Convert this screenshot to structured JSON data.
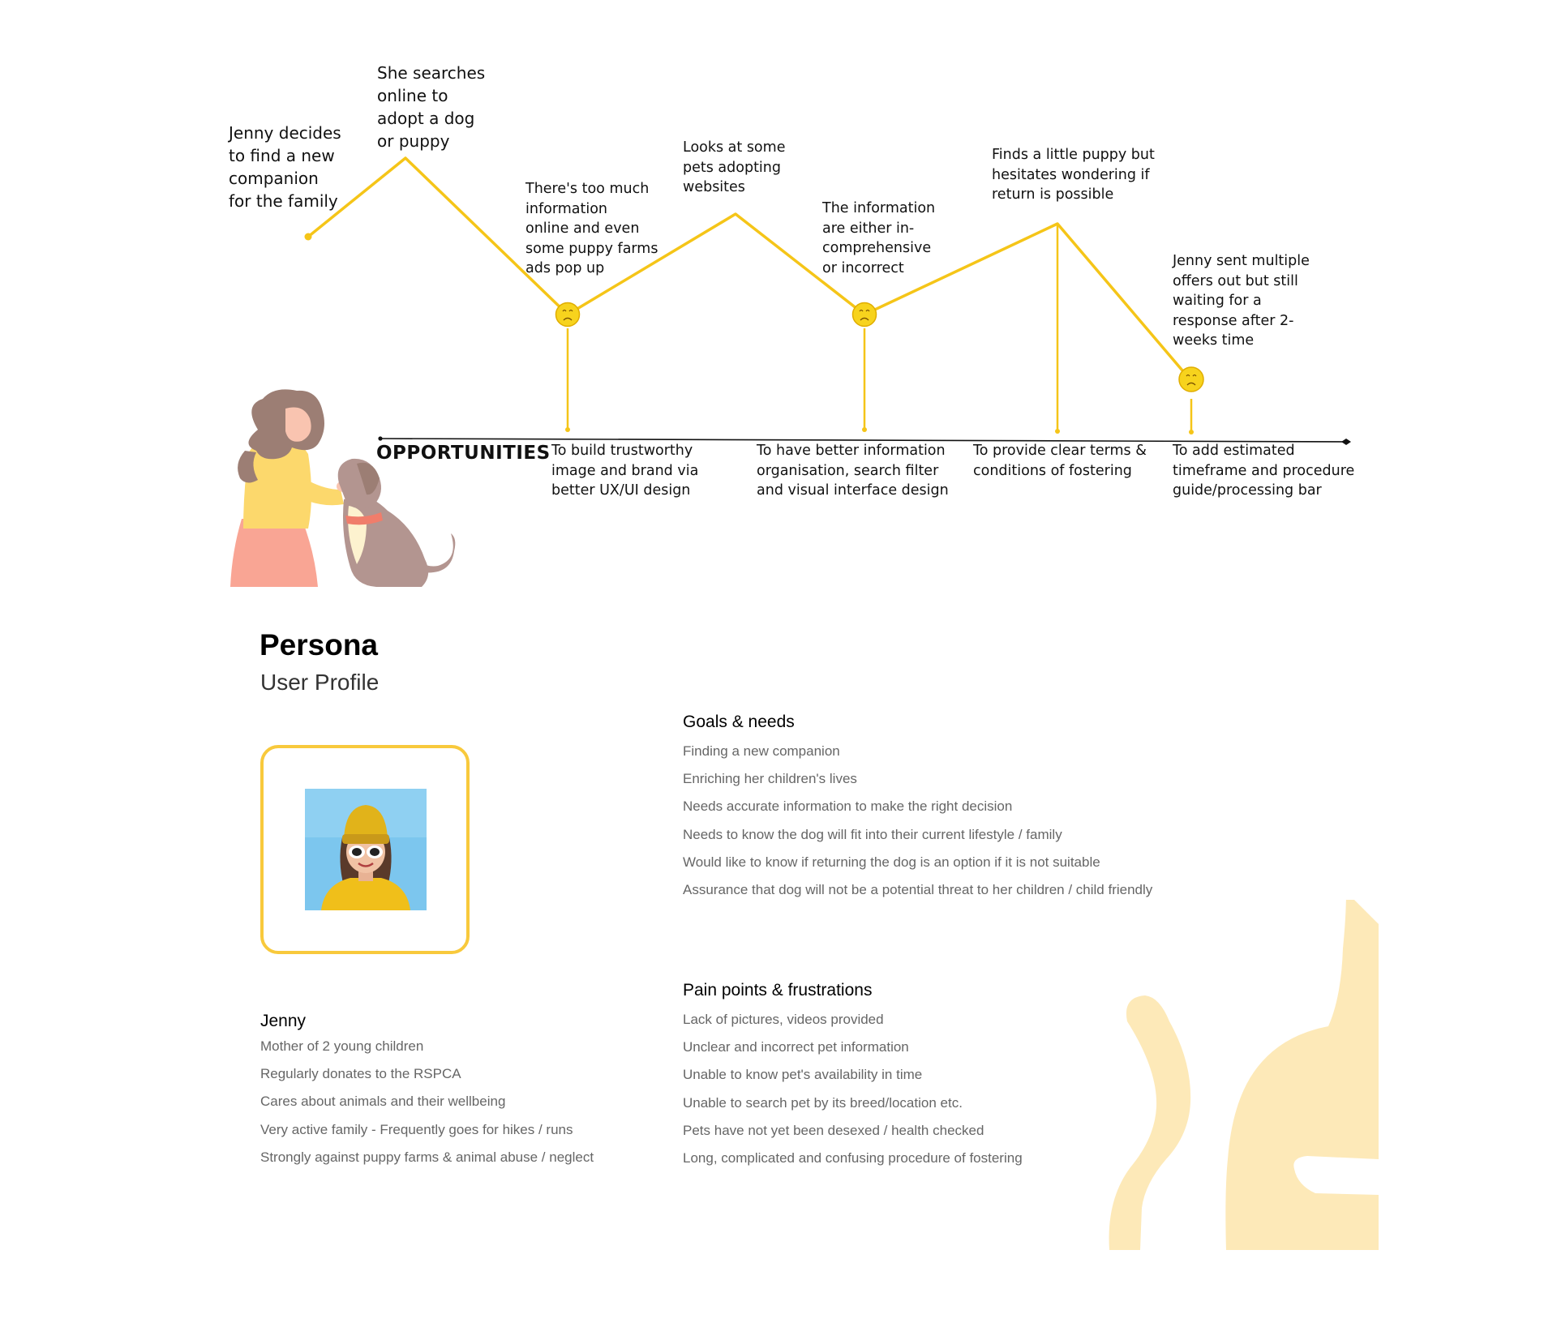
{
  "journey": {
    "steps": [
      {
        "text": "Jenny decides\nto find a new\ncompanion\nfor the family"
      },
      {
        "text": "She searches\nonline to\nadopt a dog\nor puppy"
      },
      {
        "text": "There's too much\ninformation\nonline and even\nsome puppy farms\nads pop up"
      },
      {
        "text": "Looks at some\npets adopting\nwebsites"
      },
      {
        "text": "The information\nare either in-\ncomprehensive\nor incorrect"
      },
      {
        "text": "Finds a little puppy but\nhesitates wondering if\nreturn is possible"
      },
      {
        "text": "Jenny sent multiple\noffers out but still\nwaiting for a\nresponse after 2-\nweeks time"
      }
    ],
    "line_color": "#f5c518",
    "sad_face_color": "#f7d31d"
  },
  "opportunities": {
    "heading": "OPPORTUNITIES",
    "items": [
      {
        "text": "To build trustworthy\nimage and brand via\nbetter UX/UI design"
      },
      {
        "text": "To have better information\norganisation, search filter\nand visual interface design"
      },
      {
        "text": "To provide clear terms &\nconditions of fostering"
      },
      {
        "text": "To add estimated\ntimeframe and procedure\nguide/processing bar"
      }
    ]
  },
  "persona": {
    "title": "Persona",
    "subtitle": "User Profile",
    "frame_color": "#f8c93c",
    "name": "Jenny",
    "traits": [
      "Mother of 2 young children",
      "Regularly donates to the RSPCA",
      "Cares about animals and their wellbeing",
      "Very active family - Frequently goes for hikes / runs",
      "Strongly against puppy farms & animal abuse / neglect"
    ]
  },
  "goals": {
    "heading": "Goals & needs",
    "items": [
      "Finding a new companion",
      "Enriching her children's lives",
      "Needs accurate information to make the right decision",
      "Needs to know the dog will fit into their current lifestyle / family",
      "Would like to know if returning the dog is an option if it is not suitable",
      "Assurance that dog will not be a potential threat to her children / child friendly"
    ]
  },
  "pain_points": {
    "heading": "Pain points & frustrations",
    "items": [
      "Lack of pictures, videos provided",
      "Unclear and incorrect pet information",
      "Unable to know pet's availability in time",
      "Unable to search pet by its breed/location etc.",
      "Pets have not yet been desexed / health checked",
      "Long, complicated and confusing procedure of fostering"
    ]
  },
  "decor": {
    "cat_color": "#fde9b8"
  }
}
